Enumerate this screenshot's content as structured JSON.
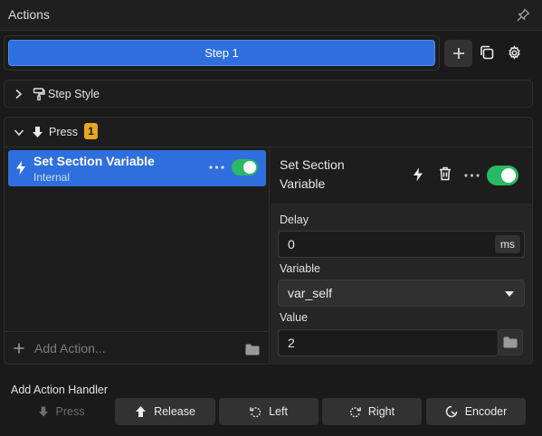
{
  "header": {
    "title": "Actions",
    "pin_icon": "pin-icon"
  },
  "step": {
    "label": "Step 1"
  },
  "step_style": {
    "label": "Step Style"
  },
  "press": {
    "label": "Press",
    "badge": "1"
  },
  "actions": {
    "items": [
      {
        "title": "Set Section Variable",
        "subtitle": "Internal",
        "enabled": true
      }
    ],
    "add_placeholder": "Add Action..."
  },
  "detail": {
    "title": "Set Section Variable",
    "enabled": true,
    "delay": {
      "label": "Delay",
      "value": "0",
      "unit": "ms"
    },
    "variable": {
      "label": "Variable",
      "selected": "var_self"
    },
    "value": {
      "label": "Value",
      "value": "2"
    }
  },
  "footer": {
    "label": "Add Action Handler",
    "buttons": [
      {
        "label": "Press",
        "icon": "arrow-down-icon",
        "enabled": false
      },
      {
        "label": "Release",
        "icon": "arrow-up-icon",
        "enabled": true
      },
      {
        "label": "Left",
        "icon": "rotate-left-icon",
        "enabled": true
      },
      {
        "label": "Right",
        "icon": "rotate-right-icon",
        "enabled": true
      },
      {
        "label": "Encoder",
        "icon": "encoder-icon",
        "enabled": true
      }
    ]
  },
  "colors": {
    "accent": "#2f6fdd",
    "toggle_on": "#2ab864",
    "badge": "#e8a720",
    "background": "#1a1a1a"
  }
}
